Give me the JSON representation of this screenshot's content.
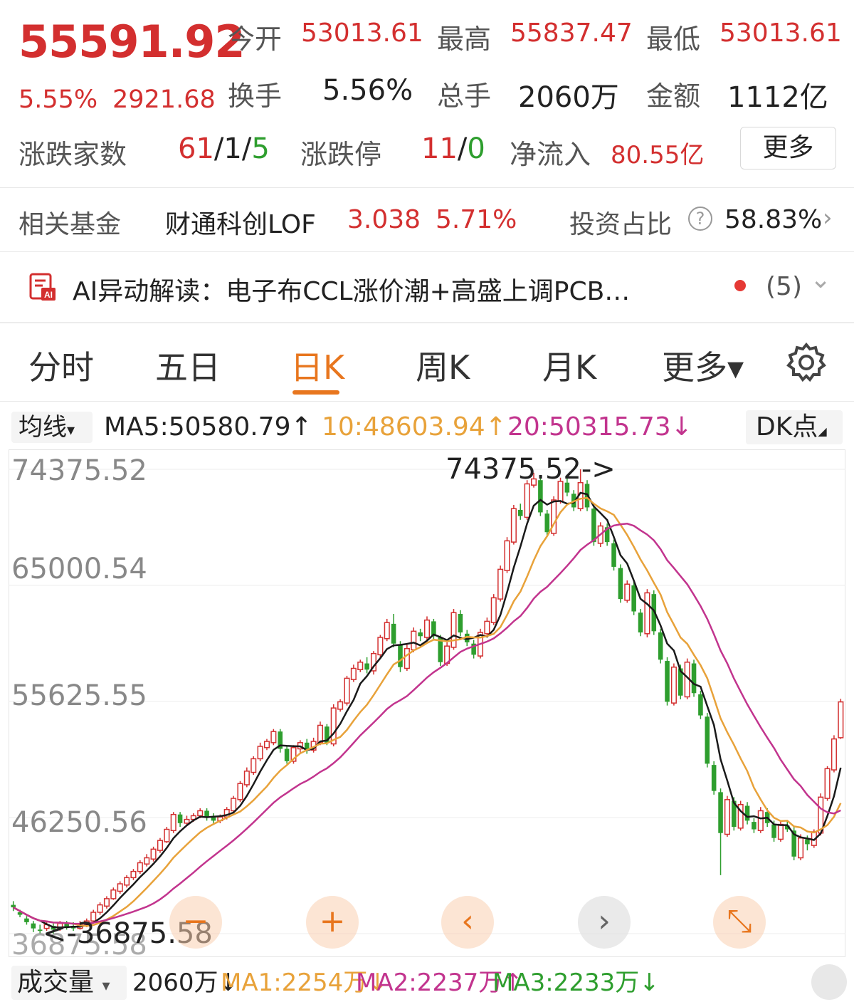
{
  "quote": {
    "price": "55591.92",
    "change_pct": "5.55%",
    "change_amt": "2921.68",
    "open_label": "今开",
    "open_value": "53013.61",
    "high_label": "最高",
    "high_value": "55837.47",
    "low_label": "最低",
    "low_value": "53013.61",
    "turnover_label": "换手",
    "turnover_value": "5.56%",
    "volume_label": "总手",
    "volume_value": "2060万",
    "amount_label": "金额",
    "amount_value": "1112亿",
    "breadth_label": "涨跌家数",
    "breadth_up": "61",
    "breadth_flat": "1",
    "breadth_down": "5",
    "limit_label": "涨跌停",
    "limit_up": "11",
    "limit_down": "0",
    "sep": "/",
    "inflow_label": "净流入",
    "inflow_value": "80.55亿",
    "more_button": "更多"
  },
  "fund": {
    "label": "相关基金",
    "name": "财通科创LOF",
    "price": "3.038",
    "change": "5.71%",
    "ratio_label": "投资占比",
    "ratio_value": "58.83%",
    "help_icon": "?",
    "chevron": "›"
  },
  "ai": {
    "icon": "ai-report-icon",
    "text": "AI异动解读：电子布CCL涨价潮+高盛上调PCB…",
    "count": "(5)",
    "expand_icon": "chevron-down-icon",
    "expand_glyph": "⌄"
  },
  "tabs": [
    {
      "label": "分时"
    },
    {
      "label": "五日"
    },
    {
      "label": "日K",
      "active": true
    },
    {
      "label": "周K"
    },
    {
      "label": "月K"
    },
    {
      "label": "更多▾"
    }
  ],
  "ma_bar": {
    "select_label": "均线",
    "select_caret": "▾",
    "ma5": "MA5:50580.79↑",
    "ma10": "10:48603.94↑",
    "ma20": "20:50315.73↓",
    "dk_label": "DK点",
    "dk_caret": "◢"
  },
  "colors": {
    "up": "#d32f2f",
    "down": "#2e9e2e",
    "ma5": "#1a1a1a",
    "ma10": "#e8a23a",
    "ma20": "#c2348e",
    "accent": "#e8761e"
  },
  "chart_data": {
    "type": "candlestick",
    "y_ticks": [
      "74375.52",
      "65000.54",
      "55625.55",
      "46250.56",
      "36875.58"
    ],
    "ylim": [
      36875.58,
      74375.52
    ],
    "max_annotation": "74375.52->",
    "min_annotation": "<-36875.58",
    "candles": [
      [
        39200,
        39000,
        39500,
        38700
      ],
      [
        38600,
        38400,
        38800,
        38200
      ],
      [
        38100,
        37800,
        38300,
        37600
      ],
      [
        37700,
        37300,
        37900,
        37000
      ],
      [
        37200,
        37100,
        37600,
        36900
      ],
      [
        37300,
        37600,
        37800,
        37100
      ],
      [
        37500,
        37200,
        37700,
        36875.58
      ],
      [
        37300,
        37700,
        37900,
        37100
      ],
      [
        37700,
        37400,
        37900,
        37200
      ],
      [
        37500,
        37300,
        37800,
        37100
      ],
      [
        37300,
        37600,
        37900,
        37200
      ],
      [
        37600,
        37900,
        38100,
        37400
      ],
      [
        37900,
        38600,
        38800,
        37800
      ],
      [
        38600,
        39200,
        39400,
        38400
      ],
      [
        39100,
        39700,
        39900,
        38900
      ],
      [
        39700,
        40400,
        40600,
        39600
      ],
      [
        40300,
        40900,
        41100,
        40100
      ],
      [
        40800,
        41400,
        41600,
        40600
      ],
      [
        41400,
        41900,
        42100,
        41200
      ],
      [
        41900,
        42600,
        42800,
        41700
      ],
      [
        42500,
        43000,
        43300,
        42300
      ],
      [
        42900,
        43700,
        43900,
        42700
      ],
      [
        43600,
        44400,
        44600,
        43400
      ],
      [
        44300,
        45300,
        45500,
        44200
      ],
      [
        45200,
        46500,
        46700,
        45000
      ],
      [
        46500,
        45800,
        46700,
        45500
      ],
      [
        45800,
        46100,
        46400,
        45600
      ],
      [
        46100,
        46400,
        46600,
        45900
      ],
      [
        46400,
        46800,
        47000,
        46200
      ],
      [
        46800,
        46300,
        47000,
        46000
      ],
      [
        46300,
        46000,
        46600,
        45800
      ],
      [
        46000,
        46300,
        46500,
        45800
      ],
      [
        46300,
        46900,
        47100,
        46100
      ],
      [
        46800,
        47800,
        48000,
        46700
      ],
      [
        47700,
        49000,
        49200,
        47500
      ],
      [
        48900,
        50000,
        50300,
        48700
      ],
      [
        49900,
        51000,
        51200,
        49700
      ],
      [
        51000,
        52000,
        52300,
        50800
      ],
      [
        51900,
        52400,
        52600,
        51700
      ],
      [
        52300,
        53200,
        53400,
        52100
      ],
      [
        53200,
        51800,
        53400,
        51500
      ],
      [
        51800,
        50800,
        52000,
        50600
      ],
      [
        50800,
        51900,
        52100,
        50600
      ],
      [
        51800,
        52300,
        52500,
        51500
      ],
      [
        52300,
        51700,
        52600,
        51400
      ],
      [
        51700,
        52400,
        52700,
        51500
      ],
      [
        52300,
        53700,
        54000,
        52100
      ],
      [
        53600,
        52300,
        53800,
        52100
      ],
      [
        52200,
        55100,
        55400,
        52000
      ],
      [
        55000,
        55600,
        55800,
        54800
      ],
      [
        55500,
        57500,
        57700,
        55300
      ],
      [
        57400,
        58300,
        58600,
        57200
      ],
      [
        58200,
        58800,
        59000,
        58000
      ],
      [
        58700,
        58200,
        59200,
        57900
      ],
      [
        58100,
        59500,
        59700,
        57800
      ],
      [
        59400,
        60800,
        61000,
        59200
      ],
      [
        60700,
        62000,
        62300,
        60500
      ],
      [
        61900,
        60300,
        62700,
        60000
      ],
      [
        60200,
        58400,
        60500,
        58000
      ],
      [
        58300,
        59900,
        60200,
        58100
      ],
      [
        59800,
        61300,
        61600,
        59600
      ],
      [
        61200,
        60900,
        61500,
        60500
      ],
      [
        60800,
        62200,
        62500,
        60600
      ],
      [
        62100,
        60900,
        62300,
        60600
      ],
      [
        60800,
        58800,
        61000,
        58500
      ],
      [
        58700,
        60100,
        60400,
        58500
      ],
      [
        60000,
        62800,
        63100,
        59800
      ],
      [
        62700,
        61200,
        63000,
        60900
      ],
      [
        61100,
        60400,
        61400,
        60100
      ],
      [
        60300,
        59400,
        60600,
        59100
      ],
      [
        59300,
        61200,
        61500,
        59100
      ],
      [
        61100,
        62100,
        62400,
        60900
      ],
      [
        62000,
        64000,
        64300,
        61800
      ],
      [
        63900,
        66300,
        66600,
        63700
      ],
      [
        66200,
        68600,
        68900,
        66000
      ],
      [
        68500,
        71200,
        71500,
        68300
      ],
      [
        71100,
        70600,
        71600,
        70300
      ],
      [
        70500,
        73200,
        73500,
        70300
      ],
      [
        73100,
        73600,
        74100,
        72900
      ],
      [
        73500,
        70900,
        73900,
        70600
      ],
      [
        70800,
        69300,
        71100,
        69000
      ],
      [
        69200,
        71900,
        72200,
        69000
      ],
      [
        71800,
        73400,
        73700,
        71600
      ],
      [
        73300,
        72500,
        73700,
        72200
      ],
      [
        72400,
        71300,
        72700,
        71000
      ],
      [
        71200,
        73300,
        74375.52,
        71000
      ],
      [
        73200,
        71300,
        73500,
        71000
      ],
      [
        71200,
        68500,
        71500,
        68200
      ],
      [
        68400,
        69800,
        70100,
        68100
      ],
      [
        69700,
        68500,
        70000,
        68200
      ],
      [
        68400,
        66500,
        68700,
        66200
      ],
      [
        66400,
        63900,
        66700,
        63600
      ],
      [
        63800,
        65100,
        65400,
        63600
      ],
      [
        65000,
        62900,
        65300,
        62600
      ],
      [
        62800,
        61200,
        63100,
        60900
      ],
      [
        61100,
        64400,
        64700,
        60800
      ],
      [
        64300,
        61300,
        64600,
        61000
      ],
      [
        61200,
        59000,
        61500,
        58700
      ],
      [
        58900,
        55600,
        59200,
        55300
      ],
      [
        55500,
        58400,
        58700,
        55300
      ],
      [
        58300,
        56100,
        58600,
        55800
      ],
      [
        56000,
        58800,
        59100,
        55800
      ],
      [
        58700,
        56300,
        59000,
        56000
      ],
      [
        56200,
        54500,
        56500,
        54200
      ],
      [
        54400,
        50600,
        54700,
        50300
      ],
      [
        50500,
        48400,
        50800,
        48100
      ],
      [
        48300,
        45000,
        48600,
        41600
      ],
      [
        44900,
        47700,
        48000,
        44700
      ],
      [
        47600,
        45500,
        47900,
        45200
      ],
      [
        45400,
        47300,
        47600,
        45200
      ],
      [
        47200,
        46000,
        47500,
        45700
      ],
      [
        45900,
        45300,
        46200,
        45000
      ],
      [
        45200,
        46800,
        47100,
        45000
      ],
      [
        46700,
        45800,
        47000,
        45500
      ],
      [
        45700,
        44600,
        46000,
        44300
      ],
      [
        44500,
        45700,
        46000,
        44300
      ],
      [
        45600,
        45300,
        46000,
        45100
      ],
      [
        45200,
        43100,
        45500,
        42800
      ],
      [
        43000,
        44600,
        44900,
        42800
      ],
      [
        44500,
        44100,
        44800,
        43600
      ],
      [
        44000,
        45100,
        45300,
        43800
      ],
      [
        45000,
        47900,
        48200,
        44800
      ],
      [
        47800,
        50200,
        50400,
        47600
      ],
      [
        50100,
        52600,
        52900,
        49900
      ],
      [
        52700,
        55591.92,
        55837.47,
        52600
      ]
    ]
  },
  "controls": {
    "zoom_out": "−",
    "zoom_in": "+",
    "prev": "‹",
    "next": "›",
    "fullscreen": "⤡"
  },
  "volume_bar": {
    "select_label": "成交量",
    "select_caret": "▾",
    "vol": "2060万↓",
    "ma1": "MA1:2254万↓",
    "ma2": "MA2:2237万↑",
    "ma3": "MA3:2233万↓"
  }
}
